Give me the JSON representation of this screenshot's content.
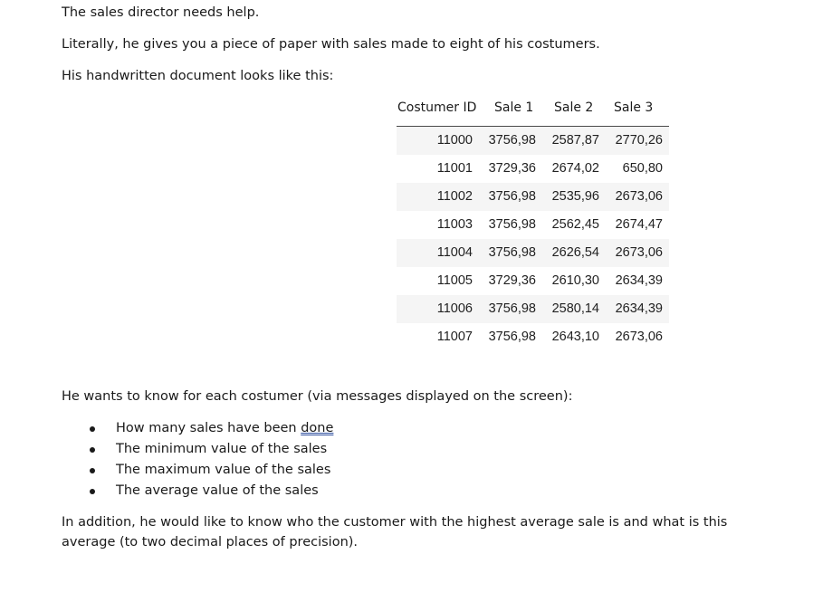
{
  "paragraphs": {
    "p1": "The sales director needs help.",
    "p2": "Literally, he gives you a piece of paper with sales made to eight of his costumers.",
    "p3": "His handwritten document looks like this:",
    "p4": "He wants to know for each costumer (via messages displayed on the screen):",
    "p5": "In addition, he would like to know who the customer with the highest average sale is and what is this average (to two decimal places of precision)."
  },
  "table": {
    "headers": [
      "Costumer ID",
      "Sale 1",
      "Sale 2",
      "Sale 3"
    ],
    "rows": [
      [
        "11000",
        "3756,98",
        "2587,87",
        "2770,26"
      ],
      [
        "11001",
        "3729,36",
        "2674,02",
        "650,80"
      ],
      [
        "11002",
        "3756,98",
        "2535,96",
        "2673,06"
      ],
      [
        "11003",
        "3756,98",
        "2562,45",
        "2674,47"
      ],
      [
        "11004",
        "3756,98",
        "2626,54",
        "2673,06"
      ],
      [
        "11005",
        "3729,36",
        "2610,30",
        "2634,39"
      ],
      [
        "11006",
        "3756,98",
        "2580,14",
        "2634,39"
      ],
      [
        "11007",
        "3756,98",
        "2643,10",
        "2673,06"
      ]
    ]
  },
  "bullets": {
    "b1_prefix": "How many sales have been ",
    "b1_word": "done",
    "b2": "The minimum value of the sales",
    "b3": "The maximum value of the sales",
    "b4": "The average value of the sales"
  },
  "colors": {
    "text": "#1a1a1a",
    "stripe": "#f5f5f5",
    "spellcheck_underline": "#2f4f9f"
  }
}
